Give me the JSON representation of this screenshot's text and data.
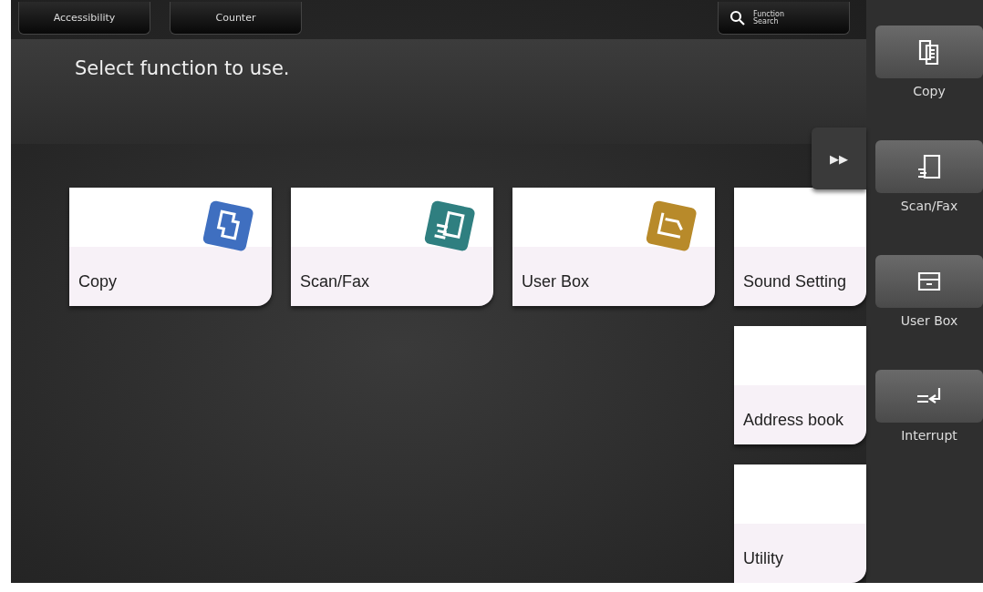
{
  "top_buttons": [
    {
      "label": "Accessibility"
    },
    {
      "label": "Counter"
    }
  ],
  "function_search": {
    "label": "Function Search"
  },
  "message": "Select function to use.",
  "expand_tab": {
    "label": "▶▶"
  },
  "tiles": [
    {
      "label": "Copy",
      "kind": "copy"
    },
    {
      "label": "Scan/Fax",
      "kind": "scan"
    },
    {
      "label": "User Box",
      "kind": "box"
    },
    {
      "label": "Sound Setting",
      "kind": "plain"
    },
    {
      "label": "Address book",
      "kind": "plain"
    },
    {
      "label": "Utility",
      "kind": "plain"
    }
  ],
  "side_panel": [
    {
      "label": "Copy",
      "kind": "copy"
    },
    {
      "label": "Scan/Fax",
      "kind": "scan"
    },
    {
      "label": "User Box",
      "kind": "box"
    },
    {
      "label": "Interrupt",
      "kind": "interrupt"
    }
  ]
}
